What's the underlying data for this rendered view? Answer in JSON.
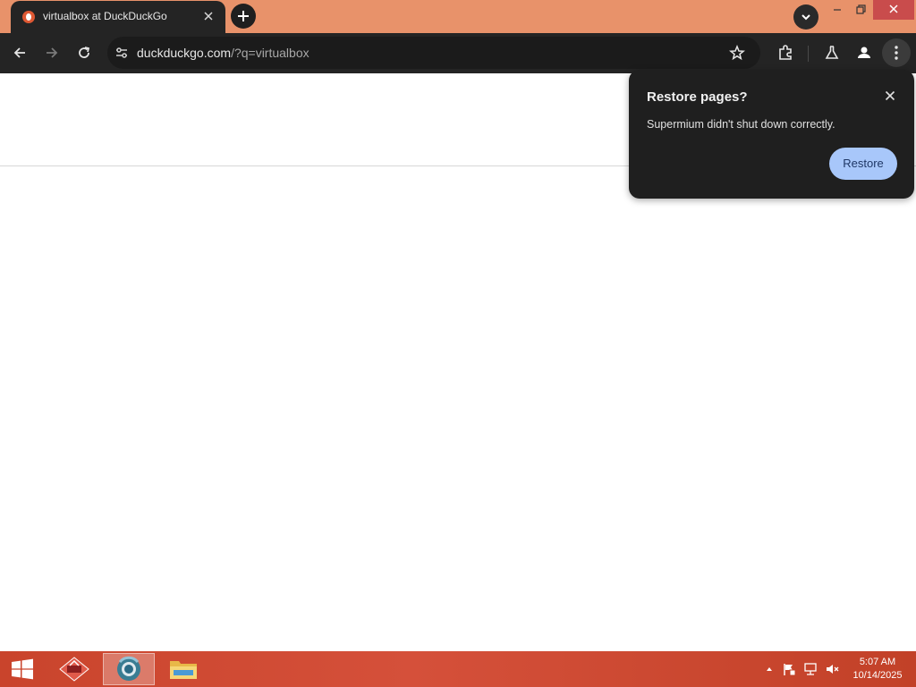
{
  "tab": {
    "title": "virtualbox at DuckDuckGo"
  },
  "omnibox": {
    "domain": "duckduckgo.com",
    "path": "/?q=virtualbox"
  },
  "restore_bubble": {
    "title": "Restore pages?",
    "message": "Supermium didn't shut down correctly.",
    "button_label": "Restore"
  },
  "taskbar": {
    "time": "5:07 AM",
    "date": "10/14/2025"
  },
  "colors": {
    "title_bar": "#e8926a",
    "toolbar": "#242424",
    "restore_button": "#a8c7fa",
    "taskbar": "#c9442c",
    "close_button": "#c94c4c"
  }
}
